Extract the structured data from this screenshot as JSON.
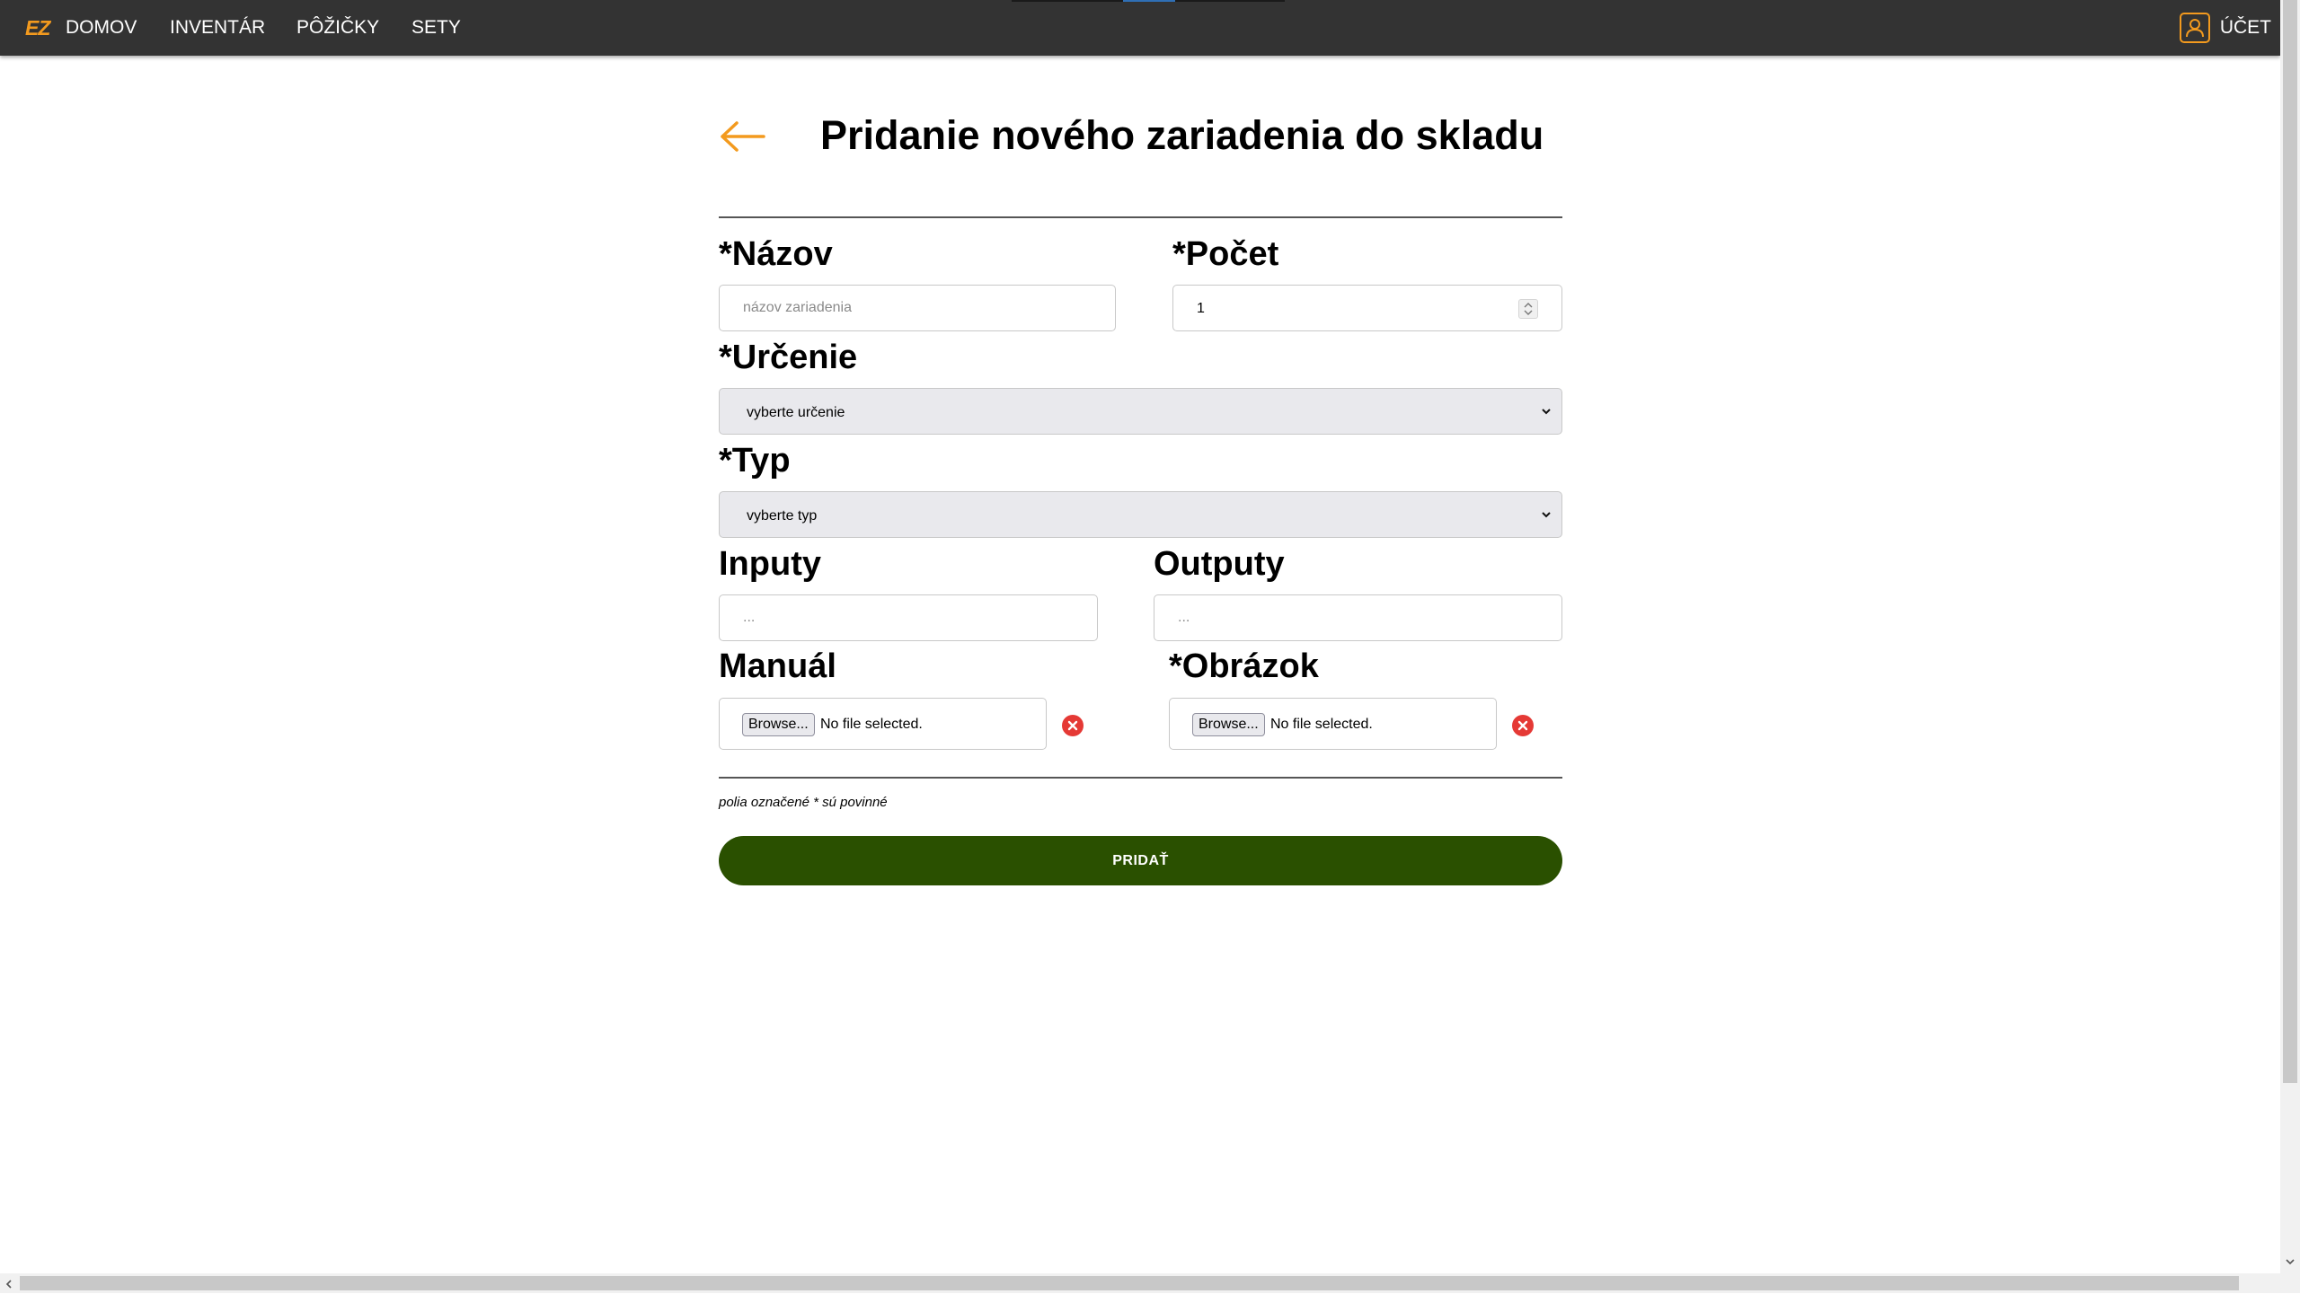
{
  "nav": {
    "brand": "EZ",
    "links": [
      "DOMOV",
      "INVENTÁR",
      "PÔŽIČKY",
      "SETY"
    ],
    "account_label": "ÚČET"
  },
  "form": {
    "title": "Pridanie nového zariadenia do skladu",
    "name_label": "*Názov",
    "name_placeholder": "názov zariadenia",
    "count_label": "*Počet",
    "count_value": "1",
    "purpose_label": "*Určenie",
    "purpose_selected": "vyberte určenie",
    "type_label": "*Typ",
    "type_selected": "vyberte typ",
    "inputs_label": "Inputy",
    "inputs_placeholder": "...",
    "outputs_label": "Outputy",
    "outputs_placeholder": "...",
    "manual_label": "Manuál",
    "image_label": "*Obrázok",
    "browse_label": "Browse...",
    "no_file_text": "No file selected.",
    "required_note": "polia označené * sú povinné",
    "submit_label": "PRIDAŤ"
  },
  "colors": {
    "navbar": "#333333",
    "accent": "#f39a1e",
    "submit": "#2a5000",
    "clear": "#e53935"
  }
}
